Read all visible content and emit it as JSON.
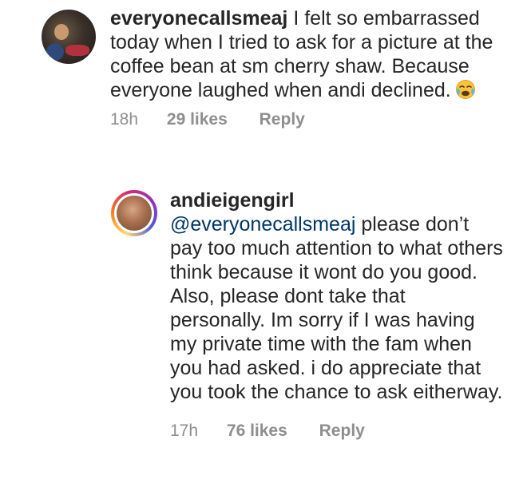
{
  "comments": [
    {
      "username": "everyonecallsmeaj",
      "text": " I felt so embarrassed today when I tried to ask for a picture at the coffee bean at sm cherry shaw. Because everyone laughed when andi declined.",
      "emoji": "crying-face",
      "time": "18h",
      "likes": "29 likes",
      "reply_label": "Reply"
    },
    {
      "username": "andieigengirl",
      "mention": "@everyonecallsmeaj",
      "text": " please don’t pay too much attention to what others think because it wont do you good. Also, please dont take that personally. Im sorry if I was having my private time with the fam when you had asked. i do appreciate that you took the chance to ask eitherway.",
      "time": "17h",
      "likes": "76 likes",
      "reply_label": "Reply"
    }
  ],
  "colors": {
    "text": "#262626",
    "meta": "#8e8e8e",
    "mention": "#003569"
  }
}
